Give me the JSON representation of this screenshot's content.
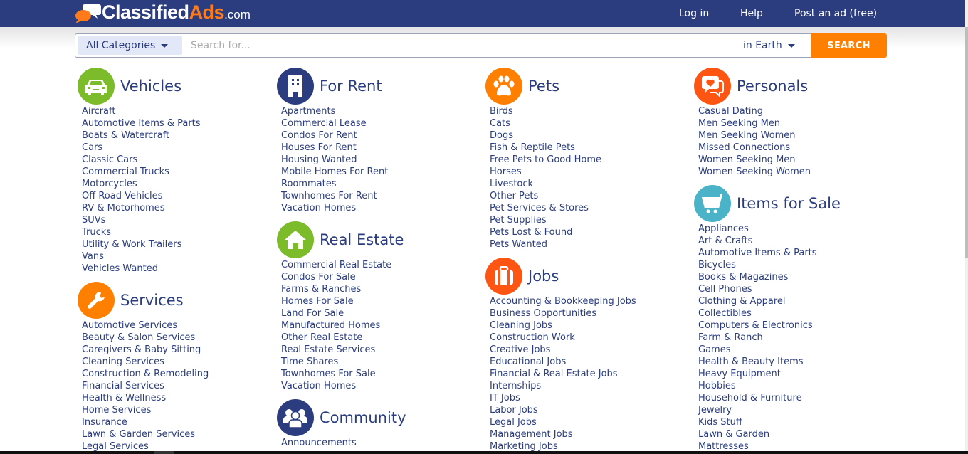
{
  "header": {
    "logo": {
      "part1": "Classified",
      "part2": "Ads",
      "part3": ".com"
    },
    "nav": {
      "login": "Log in",
      "help": "Help",
      "post_ad": "Post an ad (free)"
    }
  },
  "search": {
    "category_selected": "All Categories",
    "placeholder": "Search for...",
    "value": "",
    "location_selected": "in Earth",
    "button_label": "SEARCH"
  },
  "colors": {
    "brand_blue": "#2b3d7e",
    "accent_orange": "#ff7f00",
    "green": "#7cbb2a",
    "red_orange": "#ff5512",
    "teal": "#4bb3c8"
  },
  "sections": {
    "vehicles": {
      "title": "Vehicles",
      "icon": "car-icon",
      "items": [
        "Aircraft",
        "Automotive Items & Parts",
        "Boats & Watercraft",
        "Cars",
        "Classic Cars",
        "Commercial Trucks",
        "Motorcycles",
        "Off Road Vehicles",
        "RV & Motorhomes",
        "SUVs",
        "Trucks",
        "Utility & Work Trailers",
        "Vans",
        "Vehicles Wanted"
      ]
    },
    "services": {
      "title": "Services",
      "icon": "wrench-icon",
      "items": [
        "Automotive Services",
        "Beauty & Salon Services",
        "Caregivers & Baby Sitting",
        "Cleaning Services",
        "Construction & Remodeling",
        "Financial Services",
        "Health & Wellness",
        "Home Services",
        "Insurance",
        "Lawn & Garden Services",
        "Legal Services"
      ]
    },
    "for_rent": {
      "title": "For Rent",
      "icon": "building-icon",
      "items": [
        "Apartments",
        "Commercial Lease",
        "Condos For Rent",
        "Houses For Rent",
        "Housing Wanted",
        "Mobile Homes For Rent",
        "Roommates",
        "Townhomes For Rent",
        "Vacation Homes"
      ]
    },
    "real_estate": {
      "title": "Real Estate",
      "icon": "house-icon",
      "items": [
        "Commercial Real Estate",
        "Condos For Sale",
        "Farms & Ranches",
        "Homes For Sale",
        "Land For Sale",
        "Manufactured Homes",
        "Other Real Estate",
        "Real Estate Services",
        "Time Shares",
        "Townhomes For Sale",
        "Vacation Homes"
      ]
    },
    "community": {
      "title": "Community",
      "icon": "people-icon",
      "items": [
        "Announcements"
      ]
    },
    "pets": {
      "title": "Pets",
      "icon": "paw-icon",
      "items": [
        "Birds",
        "Cats",
        "Dogs",
        "Fish & Reptile Pets",
        "Free Pets to Good Home",
        "Horses",
        "Livestock",
        "Other Pets",
        "Pet Services & Stores",
        "Pet Supplies",
        "Pets Lost & Found",
        "Pets Wanted"
      ]
    },
    "jobs": {
      "title": "Jobs",
      "icon": "briefcase-icon",
      "items": [
        "Accounting & Bookkeeping Jobs",
        "Business Opportunities",
        "Cleaning Jobs",
        "Construction Work",
        "Creative Jobs",
        "Educational Jobs",
        "Financial & Real Estate Jobs",
        "Internships",
        "IT Jobs",
        "Labor Jobs",
        "Legal Jobs",
        "Management Jobs",
        "Marketing Jobs"
      ]
    },
    "personals": {
      "title": "Personals",
      "icon": "chat-heart-icon",
      "items": [
        "Casual Dating",
        "Men Seeking Men",
        "Men Seeking Women",
        "Missed Connections",
        "Women Seeking Men",
        "Women Seeking Women"
      ]
    },
    "items_for_sale": {
      "title": "Items for Sale",
      "icon": "cart-icon",
      "items": [
        "Appliances",
        "Art & Crafts",
        "Automotive Items & Parts",
        "Bicycles",
        "Books & Magazines",
        "Cell Phones",
        "Clothing & Apparel",
        "Collectibles",
        "Computers & Electronics",
        "Farm & Ranch",
        "Games",
        "Health & Beauty Items",
        "Heavy Equipment",
        "Hobbies",
        "Household & Furniture",
        "Jewelry",
        "Kids Stuff",
        "Lawn & Garden",
        "Mattresses"
      ]
    }
  }
}
